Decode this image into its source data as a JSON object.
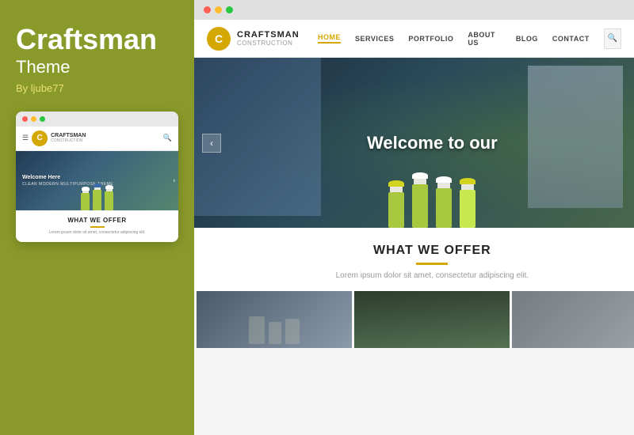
{
  "left": {
    "title": "Craftsman",
    "subtitle": "Theme",
    "author": "By ljube77",
    "mini_browser": {
      "dots": [
        "red",
        "yellow",
        "green"
      ],
      "logo": "C",
      "brand": "CRAFTSMAN",
      "brand_sub": "CONSTRUCTION",
      "hero_text": "Welcome Here",
      "hero_sub": "CLEAN MODERN MULTIPURPOSE THEME",
      "section_title": "WHAT WE OFFER",
      "section_text": "Lorem ipsum dolor sit amet, consectetur adipiscing elit."
    }
  },
  "right": {
    "browser_dots": [
      "red",
      "yellow",
      "green"
    ],
    "nav": {
      "logo_letter": "C",
      "brand": "CRAFTSMAN",
      "brand_sub": "CONSTRUCTION",
      "links": [
        "HOME",
        "SERVICES",
        "PORTFOLIO",
        "ABOUT US",
        "BLOG",
        "CONTACT"
      ],
      "active_link": "HOME",
      "search_icon": "🔍",
      "menu_icon": "☰"
    },
    "hero": {
      "title": "Welcome to our",
      "arrow_left": "‹",
      "arrow_right": "›"
    },
    "offer": {
      "title": "WHAT WE OFFER",
      "desc": "Lorem ipsum dolor sit amet, consectetur adipiscing elit."
    },
    "portfolio_items": [
      {
        "id": 1,
        "style": "people"
      },
      {
        "id": 2,
        "style": "city"
      },
      {
        "id": 3,
        "style": "interior"
      }
    ]
  },
  "colors": {
    "accent": "#d4a800",
    "background_left": "#8a9a2a",
    "text_light": "#ffffff",
    "text_gold": "#e8e070"
  }
}
